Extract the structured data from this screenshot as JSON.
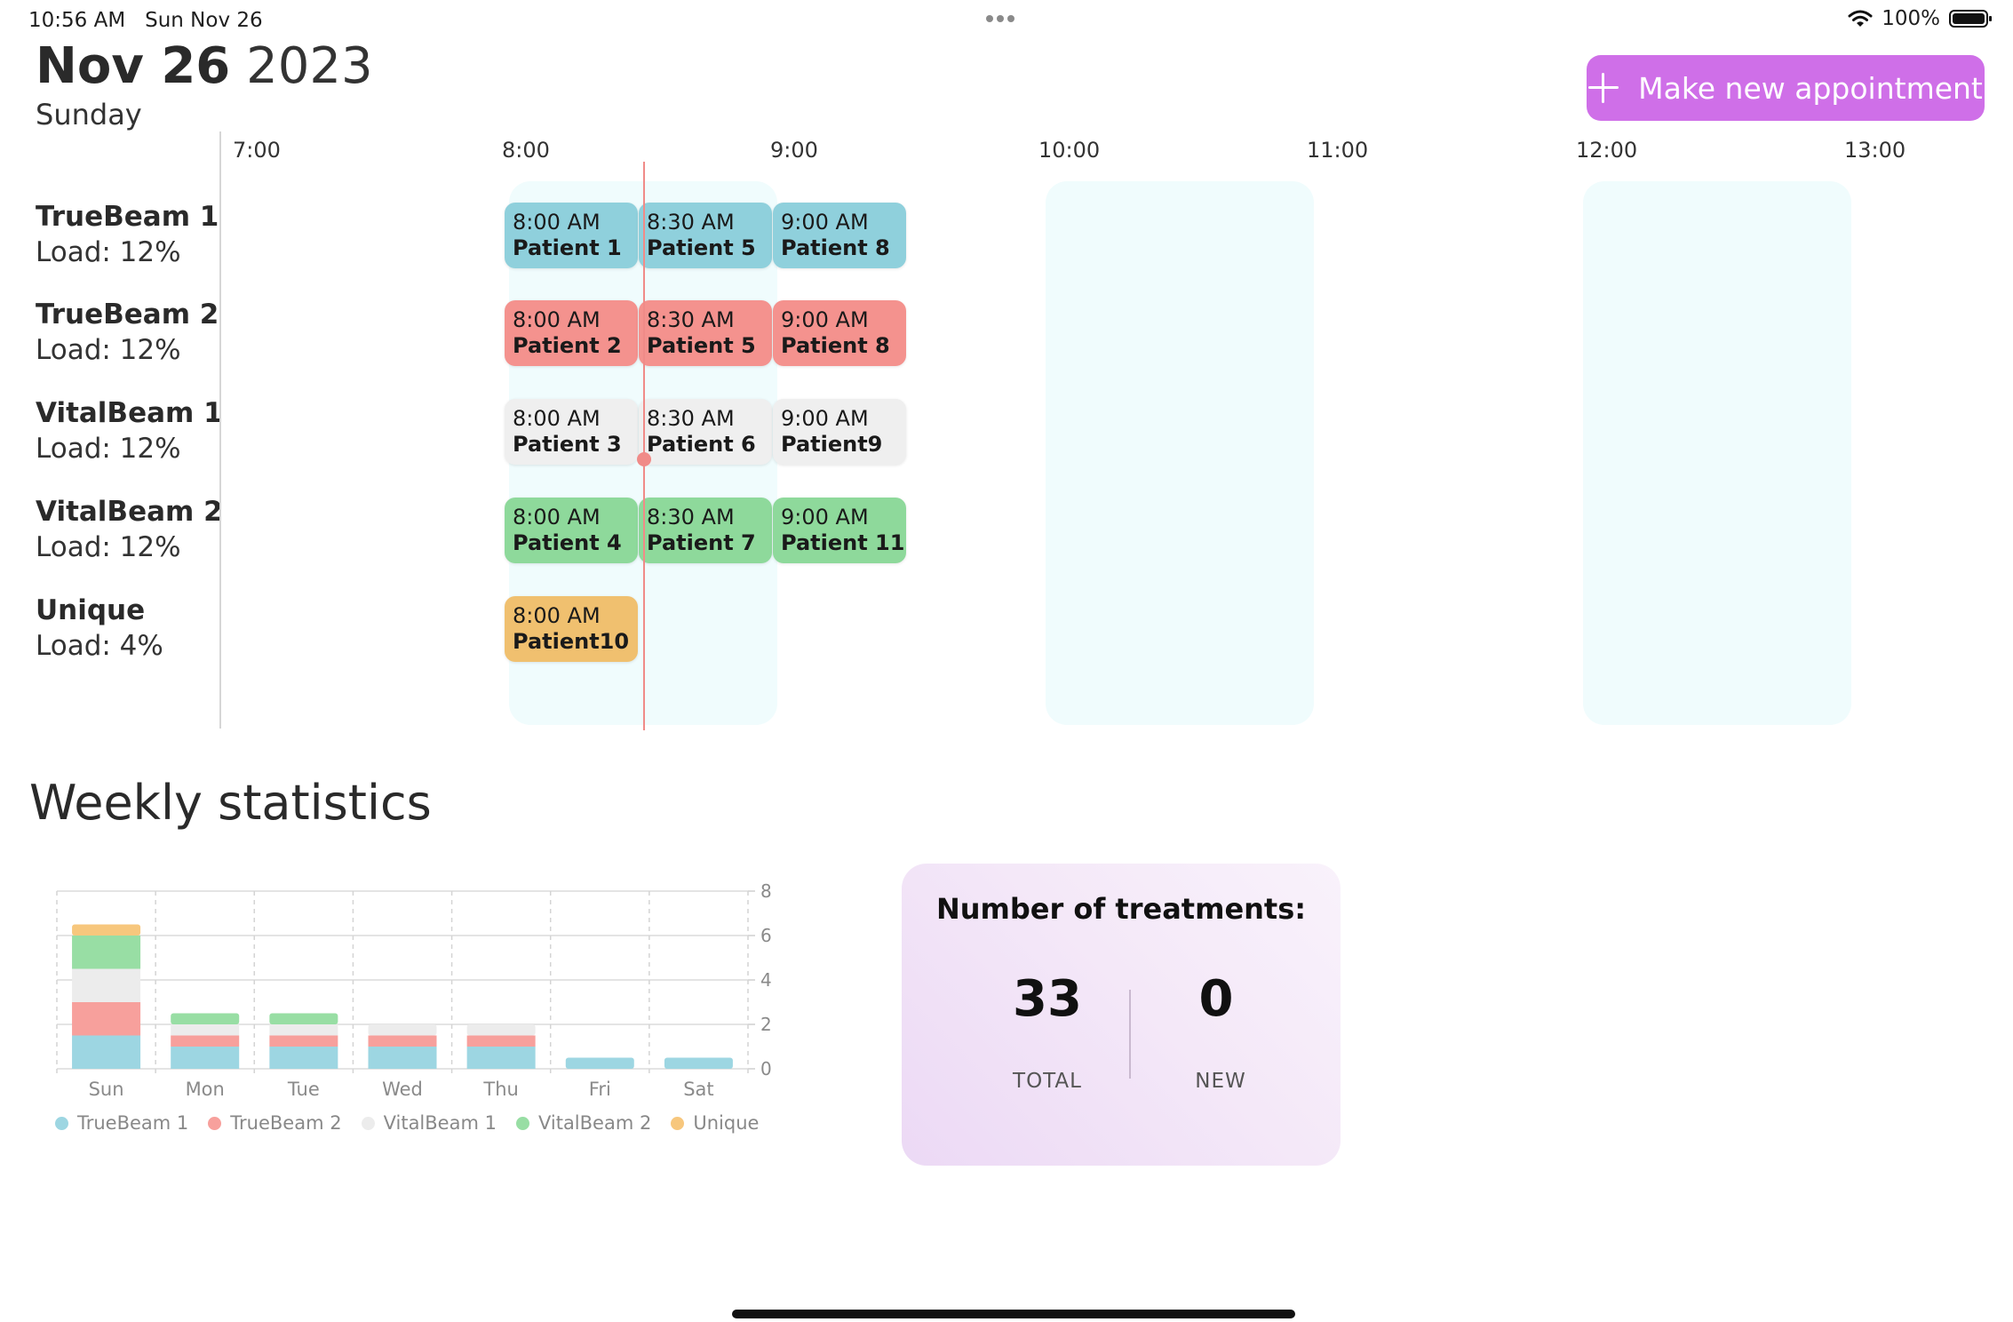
{
  "status_bar": {
    "time": "10:56 AM",
    "date": "Sun Nov 26",
    "battery": "100%"
  },
  "header": {
    "month_day": "Nov 26",
    "year": "2023",
    "weekday": "Sunday",
    "new_appointment_label": "Make new appointment"
  },
  "accent_color": "#cf6fe8",
  "hours": [
    "7:00",
    "8:00",
    "9:00",
    "10:00",
    "11:00",
    "12:00",
    "13:00"
  ],
  "resources": [
    {
      "name": "TrueBeam 1",
      "load": "Load: 12%",
      "color": "#8fd0dc"
    },
    {
      "name": "TrueBeam 2",
      "load": "Load: 12%",
      "color": "#f4928e"
    },
    {
      "name": "VitalBeam 1",
      "load": "Load: 12%",
      "color": "#efefef"
    },
    {
      "name": "VitalBeam 2",
      "load": "Load: 12%",
      "color": "#8ed99b"
    },
    {
      "name": "Unique",
      "load": "Load: 4%",
      "color": "#f0c06f"
    }
  ],
  "appointments": [
    [
      {
        "time": "8:00 AM",
        "patient": "Patient 1"
      },
      {
        "time": "8:30 AM",
        "patient": "Patient 5"
      },
      {
        "time": "9:00 AM",
        "patient": "Patient 8"
      }
    ],
    [
      {
        "time": "8:00 AM",
        "patient": "Patient 2"
      },
      {
        "time": "8:30 AM",
        "patient": "Patient 5"
      },
      {
        "time": "9:00 AM",
        "patient": "Patient 8"
      }
    ],
    [
      {
        "time": "8:00 AM",
        "patient": "Patient 3"
      },
      {
        "time": "8:30 AM",
        "patient": "Patient 6"
      },
      {
        "time": "9:00 AM",
        "patient": "Patient9"
      }
    ],
    [
      {
        "time": "8:00 AM",
        "patient": "Patient 4"
      },
      {
        "time": "8:30 AM",
        "patient": "Patient 7"
      },
      {
        "time": "9:00 AM",
        "patient": "Patient 11"
      }
    ],
    [
      {
        "time": "8:00 AM",
        "patient": "Patient10"
      }
    ]
  ],
  "weekly": {
    "title": "Weekly statistics",
    "card_title": "Number of treatments:",
    "total_value": "33",
    "total_label": "TOTAL",
    "new_value": "0",
    "new_label": "NEW"
  },
  "chart_data": {
    "type": "bar",
    "stacked": true,
    "categories": [
      "Sun",
      "Mon",
      "Tue",
      "Wed",
      "Thu",
      "Fri",
      "Sat"
    ],
    "series": [
      {
        "name": "TrueBeam 1",
        "color": "#9dd6e2",
        "values": [
          1.5,
          1,
          1,
          1,
          1,
          0.5,
          0.5
        ]
      },
      {
        "name": "TrueBeam 2",
        "color": "#f7a09c",
        "values": [
          1.5,
          0.5,
          0.5,
          0.5,
          0.5,
          0,
          0
        ]
      },
      {
        "name": "VitalBeam 1",
        "color": "#ececec",
        "values": [
          1.5,
          0.5,
          0.5,
          0.5,
          0.5,
          0,
          0
        ]
      },
      {
        "name": "VitalBeam 2",
        "color": "#98dea4",
        "values": [
          1.5,
          0.5,
          0.5,
          0,
          0,
          0,
          0
        ]
      },
      {
        "name": "Unique",
        "color": "#f7c77d",
        "values": [
          0.5,
          0,
          0,
          0,
          0,
          0,
          0
        ]
      }
    ],
    "yticks": [
      0,
      2,
      4,
      6,
      8
    ],
    "ylim": [
      0,
      8
    ],
    "grid": true,
    "legend": "bottom"
  }
}
